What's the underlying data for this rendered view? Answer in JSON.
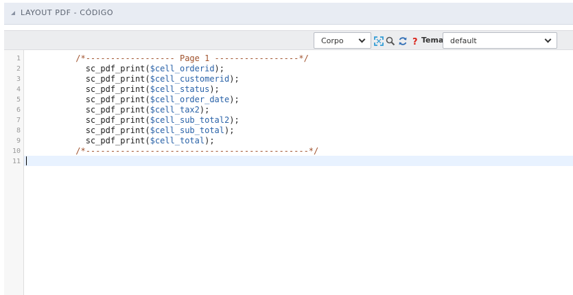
{
  "panel": {
    "title": "LAYOUT PDF - CÓDIGO"
  },
  "toolbar": {
    "section_select": "Corpo",
    "tema_label": "Tema",
    "theme_select": "default",
    "icons": [
      "fullscreen-icon",
      "search-icon",
      "refresh-icon",
      "help-icon"
    ]
  },
  "colors": {
    "comment": "#a0522d",
    "variable": "#2962a8",
    "header_bg": "#e8ecf3",
    "toolbar_bg": "#ecedef",
    "active_line": "#e8f2ff"
  },
  "editor": {
    "active_line": 11,
    "lines": [
      {
        "num": "1",
        "tokens": [
          {
            "t": "          ",
            "c": "plain"
          },
          {
            "t": "/*------------------ Page 1 -----------------*/",
            "c": "comment"
          }
        ]
      },
      {
        "num": "2",
        "tokens": [
          {
            "t": "            sc_pdf_print(",
            "c": "plain"
          },
          {
            "t": "$cell_orderid",
            "c": "var"
          },
          {
            "t": ");",
            "c": "plain"
          }
        ]
      },
      {
        "num": "3",
        "tokens": [
          {
            "t": "            sc_pdf_print(",
            "c": "plain"
          },
          {
            "t": "$cell_customerid",
            "c": "var"
          },
          {
            "t": ");",
            "c": "plain"
          }
        ]
      },
      {
        "num": "4",
        "tokens": [
          {
            "t": "            sc_pdf_print(",
            "c": "plain"
          },
          {
            "t": "$cell_status",
            "c": "var"
          },
          {
            "t": ");",
            "c": "plain"
          }
        ]
      },
      {
        "num": "5",
        "tokens": [
          {
            "t": "            sc_pdf_print(",
            "c": "plain"
          },
          {
            "t": "$cell_order_date",
            "c": "var"
          },
          {
            "t": ");",
            "c": "plain"
          }
        ]
      },
      {
        "num": "6",
        "tokens": [
          {
            "t": "            sc_pdf_print(",
            "c": "plain"
          },
          {
            "t": "$cell_tax2",
            "c": "var"
          },
          {
            "t": ");",
            "c": "plain"
          }
        ]
      },
      {
        "num": "7",
        "tokens": [
          {
            "t": "            sc_pdf_print(",
            "c": "plain"
          },
          {
            "t": "$cell_sub_total2",
            "c": "var"
          },
          {
            "t": ");",
            "c": "plain"
          }
        ]
      },
      {
        "num": "8",
        "tokens": [
          {
            "t": "            sc_pdf_print(",
            "c": "plain"
          },
          {
            "t": "$cell_sub_total",
            "c": "var"
          },
          {
            "t": ");",
            "c": "plain"
          }
        ]
      },
      {
        "num": "9",
        "tokens": [
          {
            "t": "            sc_pdf_print(",
            "c": "plain"
          },
          {
            "t": "$cell_total",
            "c": "var"
          },
          {
            "t": ");",
            "c": "plain"
          }
        ]
      },
      {
        "num": "10",
        "tokens": [
          {
            "t": "          ",
            "c": "plain"
          },
          {
            "t": "/*---------------------------------------------*/",
            "c": "comment"
          }
        ]
      },
      {
        "num": "11",
        "tokens": []
      }
    ]
  }
}
